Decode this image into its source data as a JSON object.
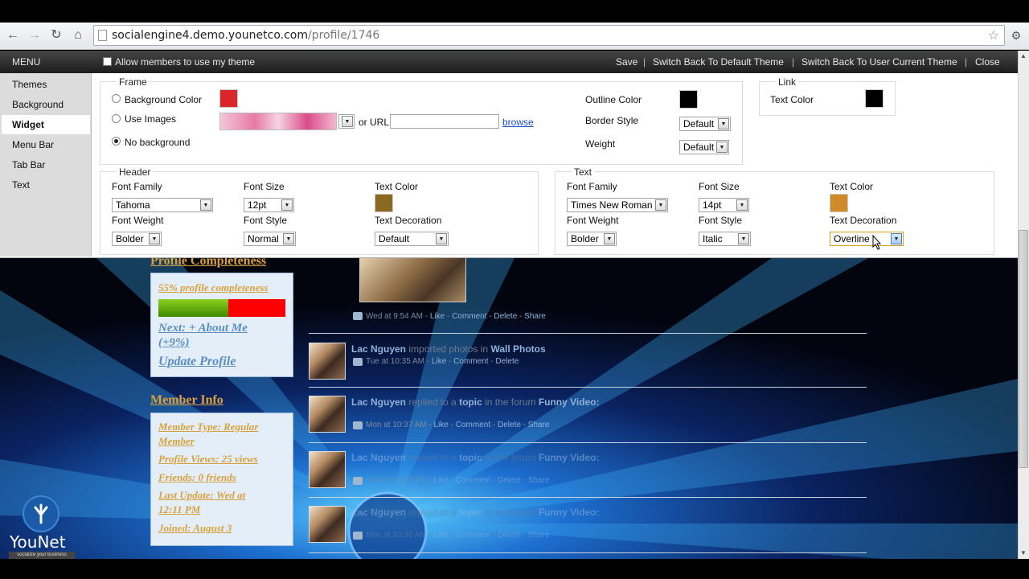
{
  "browser": {
    "url_domain": "socialengine4.demo.younetco.com",
    "url_path": "/profile/1746"
  },
  "menubar": {
    "menu": "MENU",
    "allow_members": "Allow members to use my theme",
    "save": "Save",
    "switch_default": "Switch Back To Default Theme",
    "switch_user": "Switch Back To User Current Theme",
    "close": "Close",
    "sep": "|"
  },
  "sidebar": {
    "items": [
      {
        "label": "Themes"
      },
      {
        "label": "Background"
      },
      {
        "label": "Widget"
      },
      {
        "label": "Menu Bar"
      },
      {
        "label": "Tab Bar"
      },
      {
        "label": "Text"
      }
    ]
  },
  "frame": {
    "legend": "Frame",
    "bg_color_label": "Background Color",
    "use_images_label": "Use Images",
    "no_background_label": "No background",
    "or_url": "or URL",
    "browse": "browse",
    "outline_color_label": "Outline Color",
    "border_style_label": "Border Style",
    "border_style_value": "Default",
    "weight_label": "Weight",
    "weight_value": "Default",
    "bg_color": "#d9262a",
    "outline_color": "#000000"
  },
  "link": {
    "legend": "Link",
    "text_color_label": "Text Color",
    "text_color": "#000000"
  },
  "header": {
    "legend": "Header",
    "font_family_label": "Font Family",
    "font_family_value": "Tahoma",
    "font_size_label": "Font Size",
    "font_size_value": "12pt",
    "text_color_label": "Text Color",
    "text_color": "#8a6a1e",
    "font_weight_label": "Font Weight",
    "font_weight_value": "Bolder",
    "font_style_label": "Font Style",
    "font_style_value": "Normal",
    "text_decoration_label": "Text Decoration",
    "text_decoration_value": "Default"
  },
  "text": {
    "legend": "Text",
    "font_family_label": "Font Family",
    "font_family_value": "Times New Roman",
    "font_size_label": "Font Size",
    "font_size_value": "14pt",
    "text_color_label": "Text Color",
    "text_color": "#d08a28",
    "font_weight_label": "Font Weight",
    "font_weight_value": "Bolder",
    "font_style_label": "Font Style",
    "font_style_value": "Italic",
    "text_decoration_label": "Text Decoration",
    "text_decoration_value": "Overline"
  },
  "profile": {
    "completeness_title": "Profile Completeness",
    "completeness_text": "55% profile completeness",
    "completeness_value": 0.55,
    "next_line1": "Next: + About Me",
    "next_line2": "(+9%)",
    "update_profile": "Update Profile",
    "member_info_title": "Member Info",
    "member_type_1": "Member Type: Regular",
    "member_type_2": "Member",
    "profile_views": "Profile Views: 25 views",
    "friends": "Friends: 0 friends",
    "last_update_1": "Last Update: Wed at",
    "last_update_2": "12:11 PM",
    "joined": "Joined: August 3"
  },
  "feed": {
    "item0_meta_time": "Wed at 9:54 AM",
    "dash": " - ",
    "like": "Like",
    "comment": "Comment",
    "delete": "Delete",
    "share": "Share",
    "user": "Lac Nguyen",
    "imported": "imported photos in",
    "wall_photos": "Wall Photos",
    "item1_time": "Tue at 10:35 AM",
    "replied": "replied to a",
    "topic": "topic",
    "in_forum": "in the forum",
    "forum": "Funny Video:",
    "item2_time": "Mon at 10:37 AM",
    "item3_time": "Mon at 10:36 AM"
  },
  "logo": {
    "brand": "YouNet",
    "tagline": "socialize your business"
  }
}
